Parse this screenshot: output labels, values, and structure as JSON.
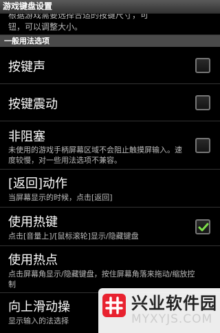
{
  "window": {
    "title": "游戏键盘设置"
  },
  "partial": {
    "line1": "根据游戏需要选择合适的按键尺寸，可",
    "line2": "钮，可以调整大小。"
  },
  "section": {
    "header": "一般用法选项"
  },
  "settings": [
    {
      "title": "按键声",
      "summary": "",
      "checked": false
    },
    {
      "title": "按键震动",
      "summary": "",
      "checked": false
    },
    {
      "title": "非阻塞",
      "summary": "未使用的游戏手柄屏幕区域不会阻止触摸屏输入。速度较慢，对一些用法选项不兼容。",
      "checked": false
    },
    {
      "title": "[返回]动作",
      "summary": "当屏幕显示的时候，点击[返回]"
    },
    {
      "title": "使用热键",
      "summary": "点击[音量上]/[鼠标滚轮]显示/隐藏键盘",
      "checked": true
    },
    {
      "title": "使用热点",
      "summary": "点击屏幕角显示/隐藏键盘，按住屏幕角落来拖动/缩放控制"
    },
    {
      "title": "向上滑动操",
      "summary": "显示输入的法选择"
    }
  ],
  "watermark": {
    "title": "兴业软件园",
    "subtitle": "MYXYJS.COM"
  }
}
